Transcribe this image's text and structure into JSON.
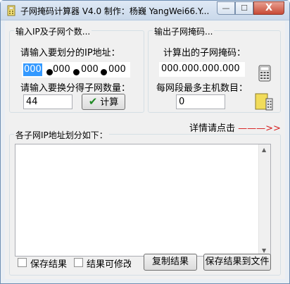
{
  "window": {
    "title": "子网掩码计算器 V4.0  制作：杨巍 YangWei66.Y...",
    "min_label": "—",
    "max_label": "☐",
    "close_label": "X"
  },
  "input_group": {
    "title": "输入IP及子网个数...",
    "ip_prompt": "请输入要划分的IP地址：",
    "ip_segments": [
      "000",
      "000",
      "000",
      "000"
    ],
    "subnet_prompt": "请输入要换分得子网数量：",
    "subnet_count": "44",
    "calc_button": "计算"
  },
  "output_group": {
    "title": "输出子网掩码...",
    "mask_prompt": "计算出的子网掩码：",
    "mask_value": "000.000.000.000",
    "hosts_prompt": "每网段最多主机数目：",
    "hosts_value": "0"
  },
  "details_link": {
    "text": "详情请点击",
    "arrow": "———>>"
  },
  "results_group": {
    "title": "各子网IP地址划分如下：",
    "content": ""
  },
  "footer": {
    "save_result_label": "保存结果",
    "editable_label": "结果可修改",
    "copy_button": "复制结果",
    "save_file_button": "保存结果到文件"
  },
  "colors": {
    "selection": "#3399ff",
    "check_green": "#1f8a24",
    "arrow_red": "#d62020"
  }
}
